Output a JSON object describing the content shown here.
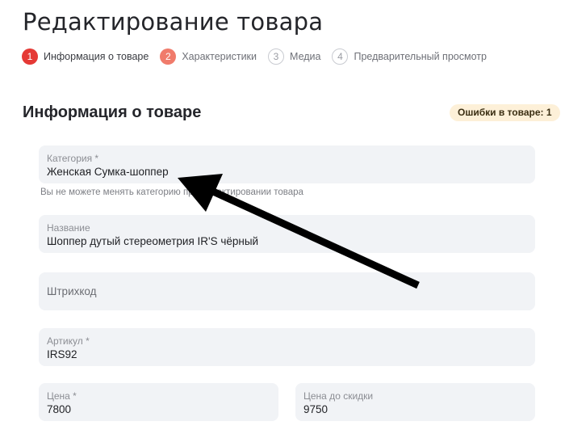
{
  "page": {
    "title": "Редактирование товара"
  },
  "stepper": {
    "steps": [
      {
        "number": "1",
        "label": "Информация о товаре",
        "state": "active"
      },
      {
        "number": "2",
        "label": "Характеристики",
        "state": "error"
      },
      {
        "number": "3",
        "label": "Медиа",
        "state": "inactive"
      },
      {
        "number": "4",
        "label": "Предварительный просмотр",
        "state": "inactive"
      }
    ]
  },
  "section": {
    "title": "Информация о товаре",
    "errors_badge": "Ошибки в товаре: 1"
  },
  "form": {
    "category": {
      "label": "Категория *",
      "value": "Женская Сумка-шоппер",
      "hint": "Вы не можете менять категорию при редактировании товара"
    },
    "name": {
      "label": "Название",
      "value": "Шоппер дутый стереометрия IR'S чёрный"
    },
    "barcode": {
      "label": "Штрихкод",
      "value": ""
    },
    "article": {
      "label": "Артикул *",
      "value": "IRS92"
    },
    "price": {
      "label": "Цена *",
      "value": "7800"
    },
    "price_before_discount": {
      "label": "Цена до скидки",
      "value": "9750"
    }
  },
  "colors": {
    "accent": "#e53935",
    "step_error": "#f07b6b",
    "field_bg": "#f1f3f6",
    "badge_bg": "#fdf0d8",
    "annotation_arrow": "#000000"
  },
  "icons": {
    "annotation": "arrow-pointer-icon"
  }
}
